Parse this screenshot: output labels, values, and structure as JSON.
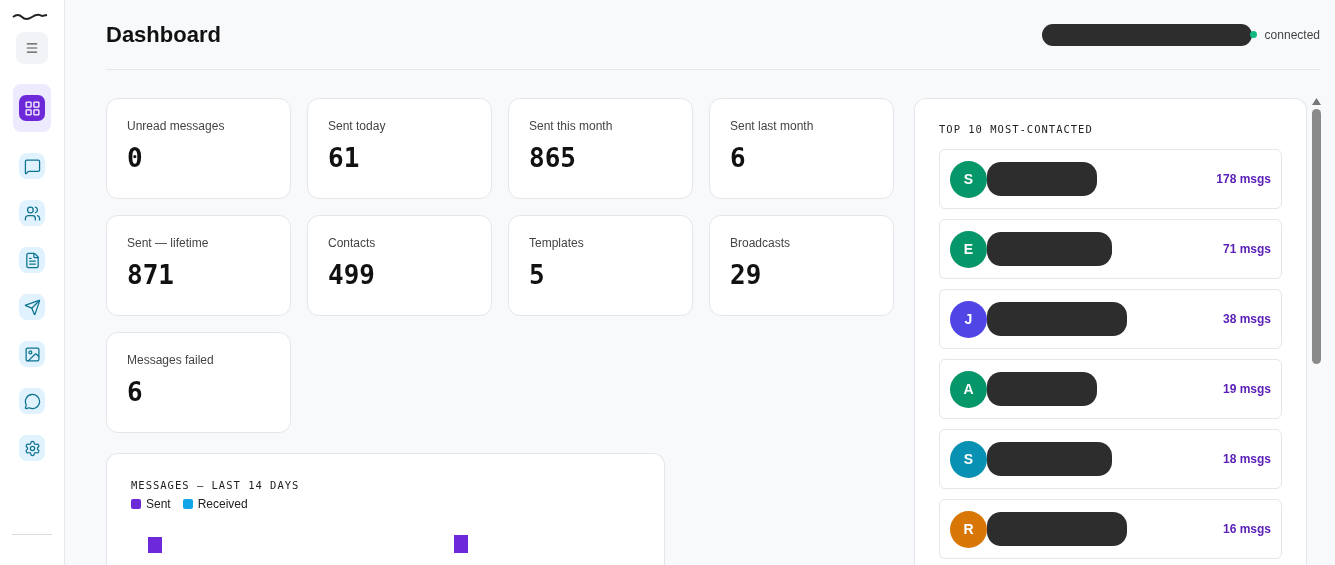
{
  "sidebar": {
    "items": [
      {
        "selected": true
      },
      {
        "selected": false
      },
      {
        "selected": false
      },
      {
        "selected": false
      },
      {
        "selected": false
      },
      {
        "selected": false
      },
      {
        "selected": false
      },
      {
        "selected": false
      }
    ]
  },
  "header": {
    "title": "Dashboard",
    "status": "connected",
    "online": true
  },
  "stats": [
    {
      "label": "Unread messages",
      "value": "0"
    },
    {
      "label": "Sent today",
      "value": "61"
    },
    {
      "label": "Sent this month",
      "value": "865"
    },
    {
      "label": "Sent last month",
      "value": "6"
    },
    {
      "label": "Sent — lifetime",
      "value": "871"
    },
    {
      "label": "Contacts",
      "value": "499"
    },
    {
      "label": "Templates",
      "value": "5"
    },
    {
      "label": "Broadcasts",
      "value": "29"
    },
    {
      "label": "Messages failed",
      "value": "6"
    }
  ],
  "messages_chart": {
    "title": "MESSAGES — LAST 14 DAYS",
    "legend": [
      {
        "label": "Sent",
        "color": "#6d28d9"
      },
      {
        "label": "Received",
        "color": "#0ea5e9"
      }
    ]
  },
  "top_contacts": {
    "title": "TOP 10 MOST-CONTACTED",
    "items": [
      {
        "initial": "S",
        "color": "#059669",
        "count": "178 msgs"
      },
      {
        "initial": "E",
        "color": "#059669",
        "count": "71 msgs"
      },
      {
        "initial": "J",
        "color": "#4f46e5",
        "count": "38 msgs"
      },
      {
        "initial": "A",
        "color": "#059669",
        "count": "19 msgs"
      },
      {
        "initial": "S",
        "color": "#0891b2",
        "count": "18 msgs"
      },
      {
        "initial": "R",
        "color": "#d97706",
        "count": "16 msgs"
      }
    ]
  }
}
